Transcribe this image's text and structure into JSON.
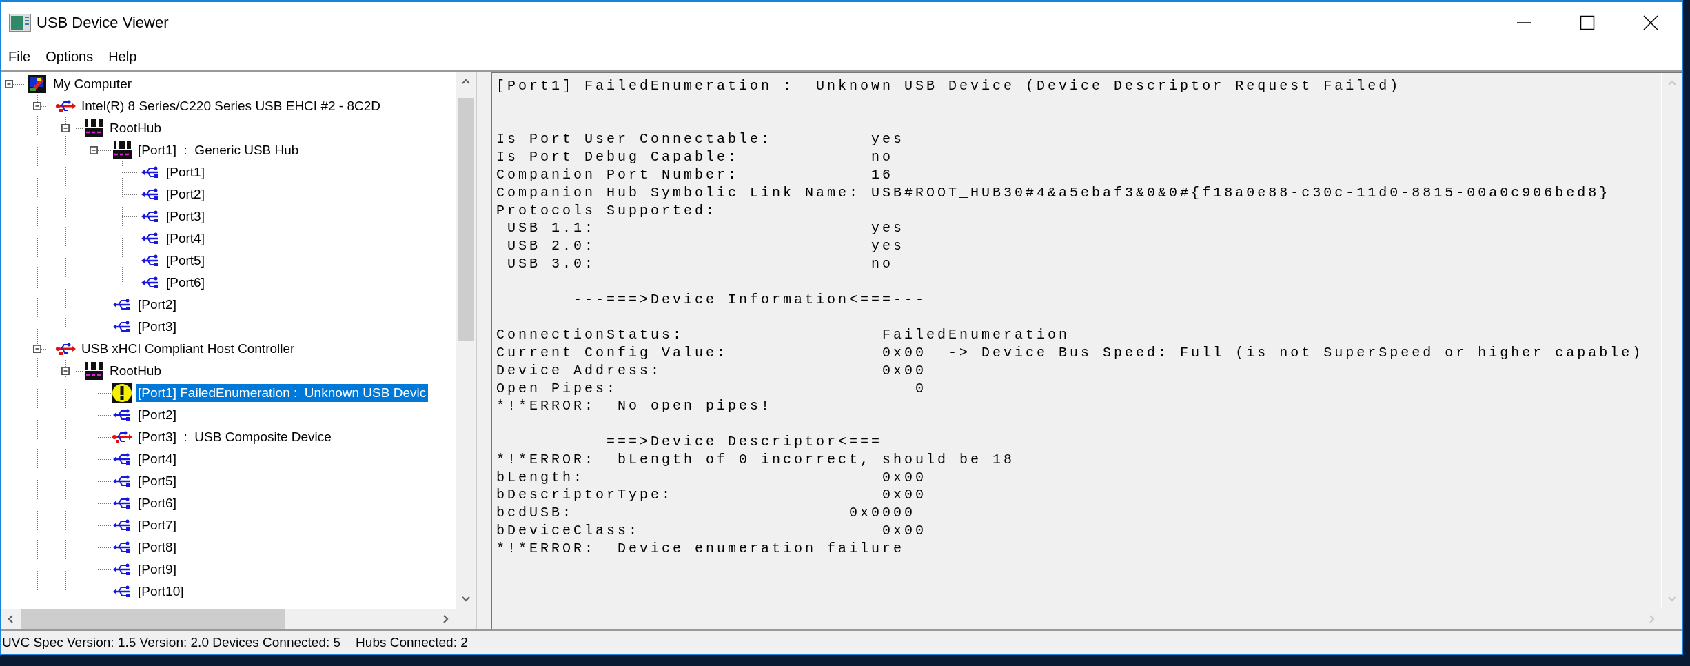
{
  "window": {
    "title": "USB Device Viewer"
  },
  "menu": [
    "File",
    "Options",
    "Help"
  ],
  "tree": [
    {
      "label": "My Computer",
      "kind": "computer",
      "expanded": true,
      "selected": false,
      "children": [
        {
          "label": "Intel(R) 8 Series/C220 Series USB EHCI #2 - 8C2D",
          "kind": "controller",
          "expanded": true,
          "selected": false,
          "children": [
            {
              "label": "RootHub",
              "kind": "hub",
              "expanded": true,
              "selected": false,
              "children": [
                {
                  "label": "[Port1]  :  Generic USB Hub",
                  "kind": "hub",
                  "expanded": true,
                  "selected": false,
                  "children": [
                    {
                      "label": "[Port1]",
                      "kind": "port",
                      "selected": false
                    },
                    {
                      "label": "[Port2]",
                      "kind": "port",
                      "selected": false
                    },
                    {
                      "label": "[Port3]",
                      "kind": "port",
                      "selected": false
                    },
                    {
                      "label": "[Port4]",
                      "kind": "port",
                      "selected": false
                    },
                    {
                      "label": "[Port5]",
                      "kind": "port",
                      "selected": false
                    },
                    {
                      "label": "[Port6]",
                      "kind": "port",
                      "selected": false
                    }
                  ]
                },
                {
                  "label": "[Port2]",
                  "kind": "port",
                  "selected": false
                },
                {
                  "label": "[Port3]",
                  "kind": "port",
                  "selected": false
                }
              ]
            }
          ]
        },
        {
          "label": "USB xHCI Compliant Host Controller",
          "kind": "controller",
          "expanded": true,
          "selected": false,
          "children": [
            {
              "label": "RootHub",
              "kind": "hub",
              "expanded": true,
              "selected": false,
              "children": [
                {
                  "label": "[Port1] FailedEnumeration :  Unknown USB Devic",
                  "kind": "error",
                  "selected": true
                },
                {
                  "label": "[Port2]",
                  "kind": "port",
                  "selected": false
                },
                {
                  "label": "[Port3]  :  USB Composite Device",
                  "kind": "device",
                  "selected": false
                },
                {
                  "label": "[Port4]",
                  "kind": "port",
                  "selected": false
                },
                {
                  "label": "[Port5]",
                  "kind": "port",
                  "selected": false
                },
                {
                  "label": "[Port6]",
                  "kind": "port",
                  "selected": false
                },
                {
                  "label": "[Port7]",
                  "kind": "port",
                  "selected": false
                },
                {
                  "label": "[Port8]",
                  "kind": "port",
                  "selected": false
                },
                {
                  "label": "[Port9]",
                  "kind": "port",
                  "selected": false
                },
                {
                  "label": "[Port10]",
                  "kind": "port",
                  "selected": false
                }
              ]
            }
          ]
        }
      ]
    }
  ],
  "details": [
    {
      "kind": "line",
      "text": "[Port1] FailedEnumeration :  Unknown USB Device (Device Descriptor Request Failed)"
    },
    {
      "kind": "blank"
    },
    {
      "kind": "blank"
    },
    {
      "kind": "line",
      "text": "Is Port User Connectable:         yes"
    },
    {
      "kind": "line",
      "text": "Is Port Debug Capable:            no"
    },
    {
      "kind": "line",
      "text": "Companion Port Number:            16"
    },
    {
      "kind": "line",
      "text": "Companion Hub Symbolic Link Name: USB#ROOT_HUB30#4&a5ebaf3&0&0#{f18a0e88-c30c-11d0-8815-00a0c906bed8}"
    },
    {
      "kind": "line",
      "text": "Protocols Supported:"
    },
    {
      "kind": "line",
      "text": " USB 1.1:                         yes"
    },
    {
      "kind": "line",
      "text": " USB 2.0:                         yes"
    },
    {
      "kind": "line",
      "text": " USB 3.0:                         no"
    },
    {
      "kind": "blank"
    },
    {
      "kind": "line",
      "text": "       ---===>Device Information<===---"
    },
    {
      "kind": "blank"
    },
    {
      "kind": "line",
      "text": "ConnectionStatus:                  FailedEnumeration"
    },
    {
      "kind": "line",
      "text": "Current Config Value:              0x00  -> Device Bus Speed: Full (is not SuperSpeed or higher capable)"
    },
    {
      "kind": "line",
      "text": "Device Address:                    0x00"
    },
    {
      "kind": "line",
      "text": "Open Pipes:                           0"
    },
    {
      "kind": "line",
      "text": "*!*ERROR:  No open pipes!"
    },
    {
      "kind": "blank"
    },
    {
      "kind": "line",
      "text": "          ===>Device Descriptor<==="
    },
    {
      "kind": "line",
      "text": "*!*ERROR:  bLength of 0 incorrect, should be 18"
    },
    {
      "kind": "line",
      "text": "bLength:                           0x00"
    },
    {
      "kind": "line",
      "text": "bDescriptorType:                   0x00"
    },
    {
      "kind": "line",
      "text": "bcdUSB:                         0x0000"
    },
    {
      "kind": "line",
      "text": "bDeviceClass:                      0x00"
    },
    {
      "kind": "line",
      "text": "*!*ERROR:  Device enumeration failure"
    }
  ],
  "status_bar": [
    "UVC Spec Version: 1.5 Version: 2.0 Devices Connected: 5",
    "Hubs Connected: 2"
  ]
}
